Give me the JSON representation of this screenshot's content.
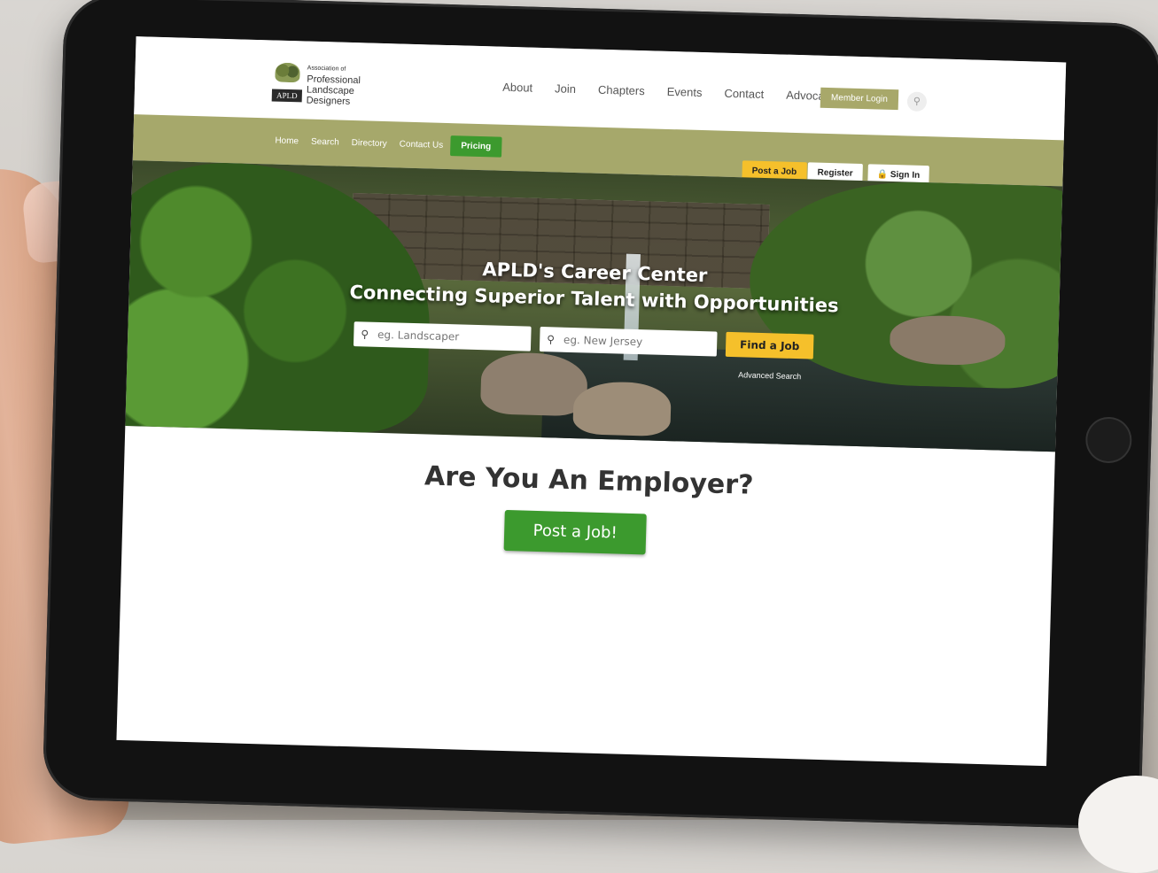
{
  "logo": {
    "line1": "Association of",
    "line2": "Professional",
    "line3": "Landscape",
    "line4": "Designers",
    "badge": "APLD"
  },
  "main_nav": [
    "About",
    "Join",
    "Chapters",
    "Events",
    "Contact",
    "Advocacy"
  ],
  "member_login_label": "Member Login",
  "search_icon": "search-icon",
  "sub_nav": [
    "Home",
    "Search",
    "Directory",
    "Contact Us"
  ],
  "pricing_label": "Pricing",
  "post_job_small_label": "Post a Job",
  "register_label": "Register",
  "sign_in_label": "Sign In",
  "hero": {
    "title": "APLD's Career Center",
    "subtitle": "Connecting Superior Talent with Opportunities",
    "keyword_placeholder": "eg. Landscaper",
    "location_placeholder": "eg. New Jersey",
    "find_label": "Find a Job",
    "advanced_search": "Advanced Search"
  },
  "employer": {
    "title": "Are You An Employer?",
    "post_label": "Post a Job!"
  },
  "colors": {
    "olive": "#a6a86b",
    "green": "#3c9a2e",
    "yellow": "#f5c02b"
  }
}
